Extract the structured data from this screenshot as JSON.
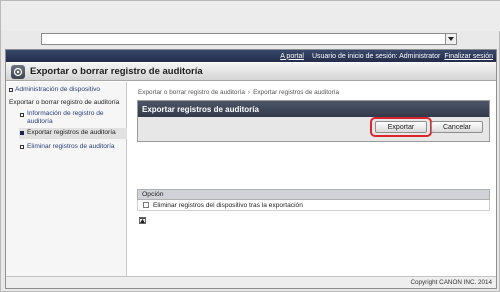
{
  "topbar": {
    "portal_link": "A portal",
    "login_user": "Usuario de inicio de sesión: Administrator",
    "logout_link": "Finalizar sesión"
  },
  "title": "Exportar o borrar registro de auditoría",
  "sidebar": {
    "device_admin_link": "Administración de dispositivo",
    "section": "Exportar o borrar registro de auditoría",
    "items": [
      {
        "label_line1": "Información de registro de",
        "label_line2": "auditoría"
      },
      {
        "label": "Exportar registros de auditoría"
      },
      {
        "label": "Eliminar registros de auditoría"
      }
    ]
  },
  "breadcrumb": {
    "parent": "Exportar o borrar registro de auditoría",
    "sep": "›",
    "current": "Exportar registros de auditoría"
  },
  "panel": {
    "title": "Exportar registros de auditoría",
    "export_button": "Exportar",
    "cancel_button": "Cancelar"
  },
  "option": {
    "header": "Opción",
    "checkbox_label": "Eliminar registros del dispositivo tras la exportación",
    "checked": false
  },
  "footer": {
    "copyright": "Copyright CANON INC. 2014"
  },
  "colors": {
    "topbar": "#2b3554",
    "panel_header": "#3f4759",
    "highlight": "#d8262c"
  }
}
